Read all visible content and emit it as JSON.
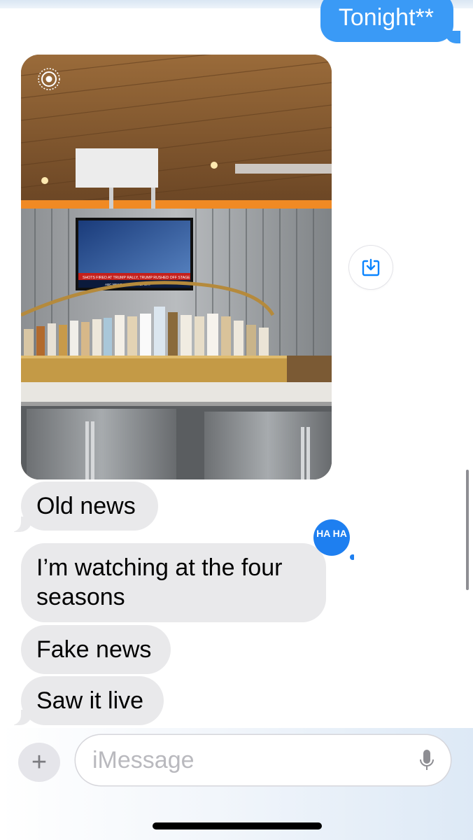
{
  "messages": {
    "outgoing": [
      {
        "text": "Tonight**"
      }
    ],
    "photo": {
      "tv_ticker": "SHOTS FIRED AT TRUMP RALLY, TRUMP RUSHED OFF STAGE",
      "tv_network": "ABC NEWS SPECIAL REPORT"
    },
    "incoming": [
      {
        "text": "Old news"
      },
      {
        "text": "I’m watching at the four seasons",
        "reaction": "HA HA"
      },
      {
        "text": "Fake news"
      },
      {
        "text": "Saw it live"
      }
    ]
  },
  "composer": {
    "placeholder": "iMessage",
    "plus_icon": "plus-icon",
    "mic_icon": "microphone-icon"
  },
  "icons": {
    "live_photo": "live-photo-icon",
    "save": "save-download-icon"
  },
  "colors": {
    "outgoing_bubble": "#3a9af6",
    "incoming_bubble": "#e9e9eb",
    "accent": "#0a84ff"
  }
}
